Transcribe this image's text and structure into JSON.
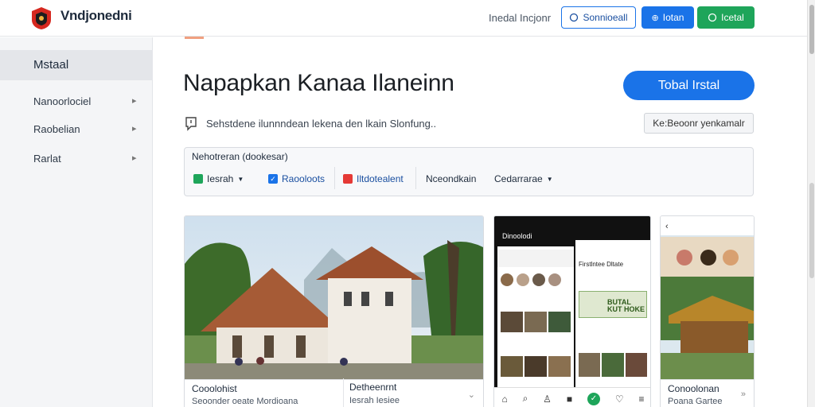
{
  "header": {
    "brand": "Vndjonedni",
    "link": "Inedal Incjonr",
    "btn_outline": "Sonnioeall",
    "btn_blue": "Iotan",
    "btn_green": "Icetal"
  },
  "sidebar": {
    "active": "Mstaal",
    "items": [
      {
        "label": "Nanoorlociel"
      },
      {
        "label": "Raobelian"
      },
      {
        "label": "Rarlat"
      }
    ]
  },
  "main": {
    "title": "Napapkan Kanaa Ilaneinn",
    "install_label": "Tobal Irstal",
    "subtitle": "Sehstdene ilunnndean lekena den lkain Slonfung..",
    "secondary_btn": "Ke:Beoonr yenkamalr"
  },
  "filters": {
    "title": "Nehotreran (dookesar)",
    "chips": [
      {
        "label": "Iesrah",
        "color": "#1ea55a",
        "dropdown": true
      },
      {
        "label": "Raooloots",
        "color": "#1a73e8",
        "checked": true
      },
      {
        "label": "Iltdotealent",
        "color": "#e53935"
      },
      {
        "label": "Nceondkain"
      },
      {
        "label": "Cedarrarae",
        "dropdown": true
      }
    ]
  },
  "cards": [
    {
      "title": "Cooolohist",
      "sub": "Seoonder oeate Mordioana"
    },
    {
      "title": "Detheenrnt",
      "sub": "Iesrah Iesiee"
    },
    {
      "title": "Conoolonan",
      "sub": "Poana Gartee"
    }
  ],
  "phone": {
    "header": "Dinoolodi",
    "panel_title": "Firstlntee Dltate",
    "banner": "BUTAL\nKUT HOKE"
  },
  "colors": {
    "primary": "#1a73e8",
    "green": "#1ea55a",
    "red": "#e53935"
  }
}
